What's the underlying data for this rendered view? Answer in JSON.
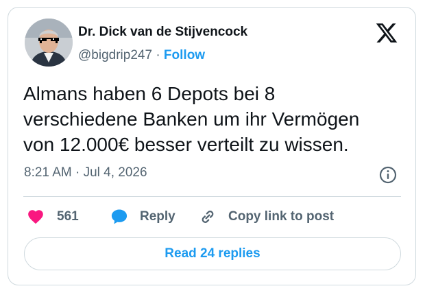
{
  "author": {
    "display_name": "Dr. Dick van de Stijvencock",
    "handle": "@bigdrip247",
    "separator": "·",
    "follow_label": "Follow"
  },
  "tweet": {
    "lines": [
      "Almans haben 6 Depots bei 8",
      "verschiedene Banken um ihr Vermögen",
      "von 12.000€ besser verteilt zu wissen."
    ],
    "timestamp": "8:21 AM · Jul 4, 2026"
  },
  "actions": {
    "like_count": "561",
    "reply_label": "Reply",
    "copy_label": "Copy link to post"
  },
  "read_replies_label": "Read 24 replies",
  "colors": {
    "accent": "#1d9bf0",
    "like": "#f91880",
    "text": "#0f1419",
    "muted": "#536471",
    "border": "#cfd9de"
  },
  "icons": {
    "platform": "x-logo-icon",
    "info": "info-icon",
    "like": "heart-icon",
    "reply": "speech-bubble-icon",
    "copy": "link-icon"
  }
}
